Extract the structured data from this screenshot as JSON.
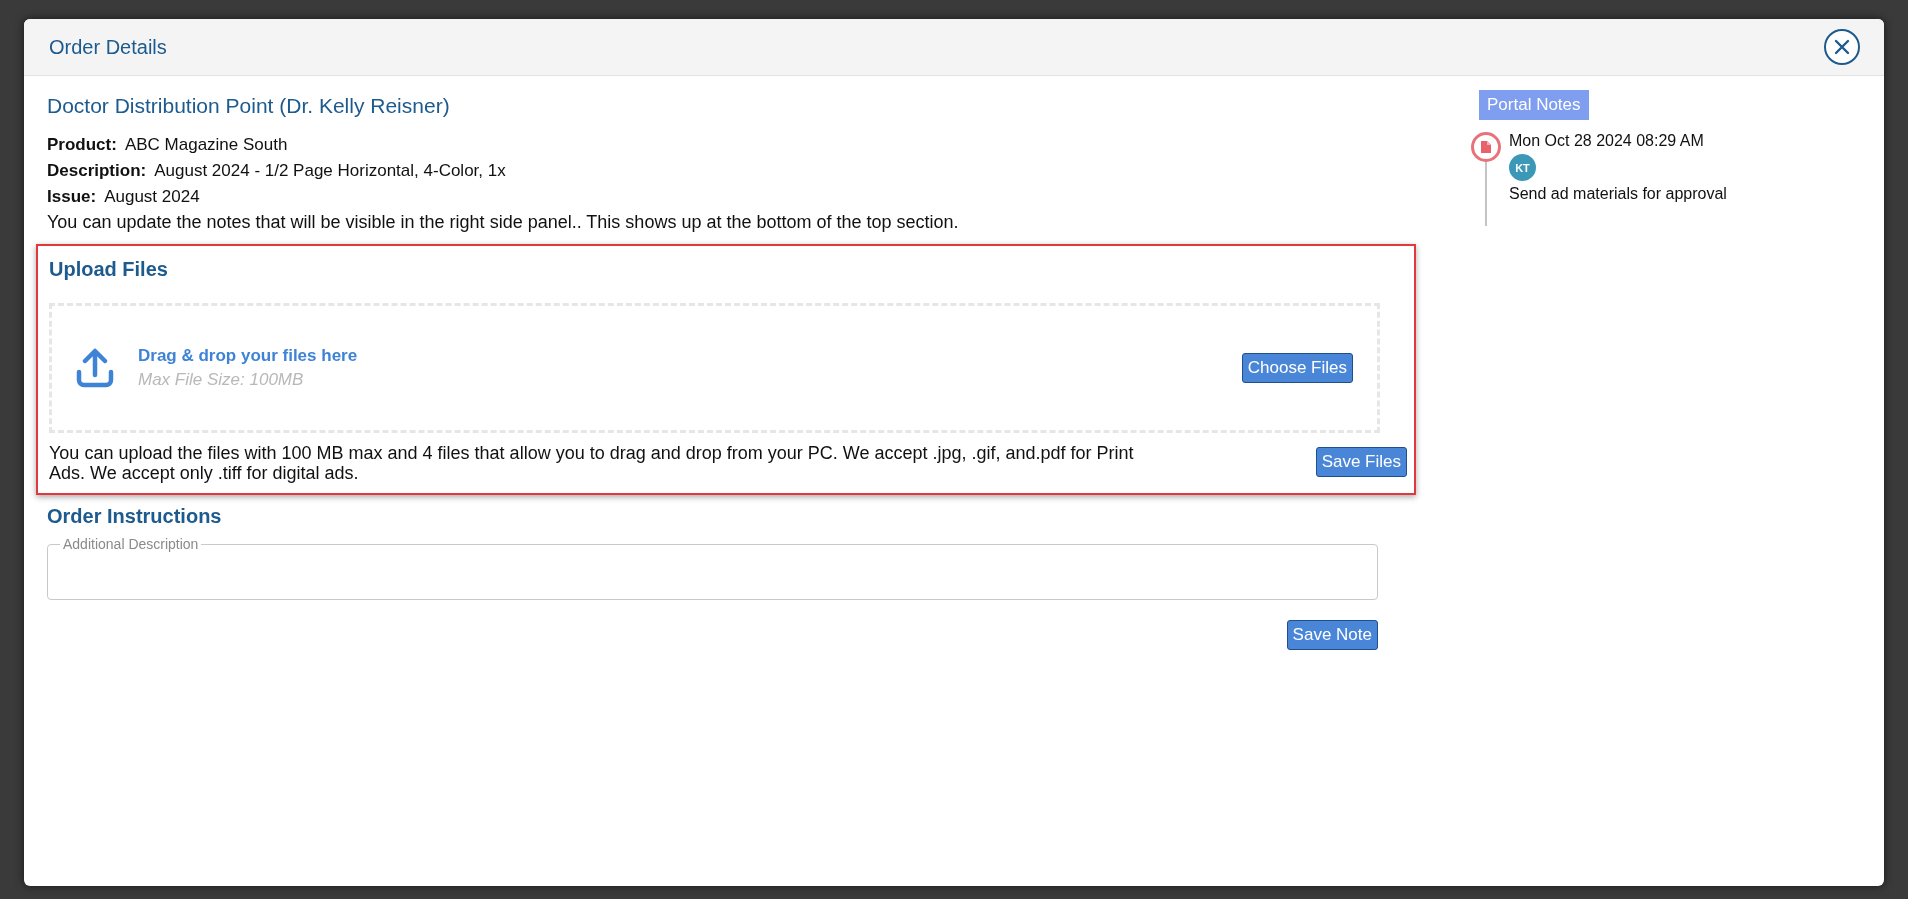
{
  "dialog": {
    "title": "Order Details"
  },
  "order": {
    "name": "Doctor Distribution Point (Dr. Kelly Reisner)",
    "fields": [
      {
        "label": "Product:",
        "value": "ABC Magazine South"
      },
      {
        "label": "Description:",
        "value": "August 2024 - 1/2 Page Horizontal, 4-Color, 1x"
      },
      {
        "label": "Issue:",
        "value": "August 2024"
      }
    ],
    "note": "You can update the notes that will be visible in the right side panel.. This shows up at the bottom of the top section."
  },
  "upload": {
    "title": "Upload Files",
    "drop_text": "Drag & drop your files here",
    "max_size": "Max File Size: 100MB",
    "choose_button": "Choose Files",
    "help": "You can upload the files with 100 MB max and 4 files that allow you to drag and drop from your PC. We accept .jpg, .gif, and.pdf for Print Ads. We accept only .tiff for digital ads.",
    "save_button": "Save Files"
  },
  "instructions": {
    "title": "Order Instructions",
    "field_label": "Additional Description",
    "save_button": "Save Note"
  },
  "portal_notes": {
    "title": "Portal Notes",
    "entries": [
      {
        "date": "Mon Oct 28 2024 08:29 AM",
        "initials": "KT",
        "text": "Send ad materials for approval"
      }
    ]
  }
}
